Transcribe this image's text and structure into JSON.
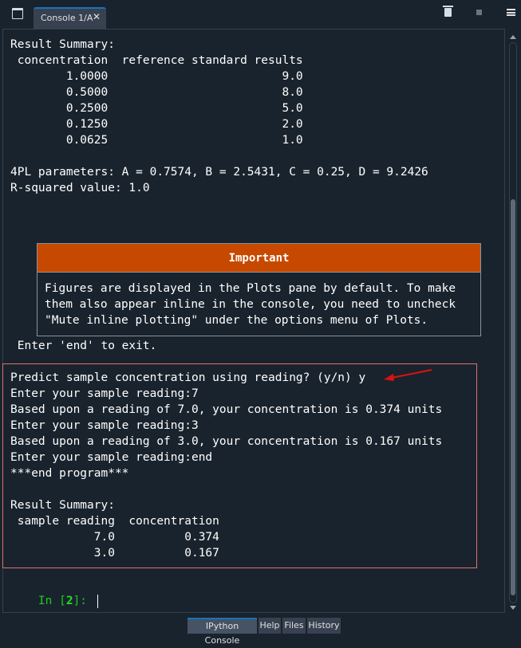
{
  "tabs": {
    "console_tab": "Console 1/A",
    "close_glyph": "✕"
  },
  "icons": {
    "window": "window-icon",
    "trash": "trash-icon",
    "stop": "stop-icon",
    "menu": "hamburger-menu-icon"
  },
  "console": {
    "lines": [
      "Result Summary:",
      " concentration  reference standard results",
      "        1.0000                         9.0",
      "        0.5000                         8.0",
      "        0.2500                         5.0",
      "        0.1250                         2.0",
      "        0.0625                         1.0",
      "",
      "",
      "4PL parameters: A = 0.7574, B = 2.5431, C = 0.25, D = 9.2426",
      "R-squared value: 1.0"
    ],
    "important": {
      "title": "Important",
      "lines": [
        "Figures are displayed in the Plots pane by default. To make",
        "them also appear inline in the console, you need to uncheck",
        "\"Mute inline plotting\" under the options menu of Plots."
      ]
    },
    "exit_line": " Enter 'end' to exit.",
    "session_lines": [
      "Predict sample concentration using reading? (y/n) y",
      "Enter your sample reading:7",
      "Based upon a reading of 7.0, your concentration is 0.374 units",
      "Enter your sample reading:3",
      "Based upon a reading of 3.0, your concentration is 0.167 units",
      "Enter your sample reading:end",
      "***end program***",
      "",
      "Result Summary:",
      " sample reading  concentration",
      "            7.0          0.374",
      "            3.0          0.167"
    ],
    "prompt": {
      "prefix": "In [",
      "number": "2",
      "suffix": "]: "
    },
    "colors": {
      "highlight_border": "#e07070",
      "arrow": "#dd1111",
      "important_header": "#c74900",
      "prompt_green": "#1ec91e"
    }
  },
  "bottom_tabs": [
    "IPython Console",
    "Help",
    "Files",
    "History"
  ]
}
